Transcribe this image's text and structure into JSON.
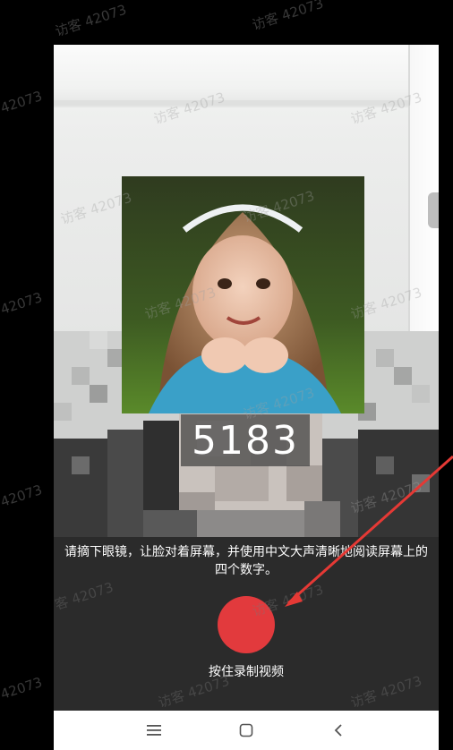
{
  "verification": {
    "digits": "5183",
    "instruction": "请摘下眼镜，让脸对着屏幕，并使用中文大声清晰地阅读屏幕上的四个数字。",
    "record_button_label": "按住录制视频"
  },
  "watermark": {
    "text_full": "访客 42073",
    "text_short": "42073",
    "text_partial": "客 42073"
  },
  "navbar": {
    "menu_icon": "menu-icon",
    "home_icon": "square-home-icon",
    "back_icon": "back-chevron-icon"
  },
  "colors": {
    "record_button": "#e23a3d",
    "annotation_arrow": "#e53935",
    "panel_bg": "#2b2b2b"
  }
}
